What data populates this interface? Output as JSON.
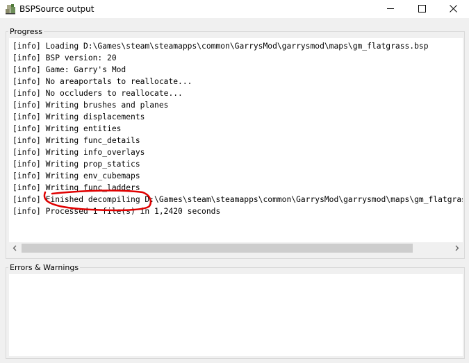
{
  "window": {
    "title": "BSPSource output",
    "app_icon": "bspsource-app-icon",
    "controls": [
      "minimize-icon",
      "maximize-icon",
      "close-icon"
    ]
  },
  "progress": {
    "label": "Progress",
    "lines": [
      "[info] Loading D:\\Games\\steam\\steamapps\\common\\GarrysMod\\garrysmod\\maps\\gm_flatgrass.bsp",
      "[info] BSP version: 20",
      "[info] Game: Garry's Mod",
      "[info] No areaportals to reallocate...",
      "[info] No occluders to reallocate...",
      "[info] Writing brushes and planes",
      "[info] Writing displacements",
      "[info] Writing entities",
      "[info] Writing func_details",
      "[info] Writing info_overlays",
      "[info] Writing prop_statics",
      "[info] Writing env_cubemaps",
      "[info] Writing func_ladders",
      "[info] Finished decompiling D:\\Games\\steam\\steamapps\\common\\GarrysMod\\garrysmod\\maps\\gm_flatgrass.bsp",
      "[info] Processed 1 file(s) in 1,2420 seconds"
    ],
    "highlight_color": "#e00000"
  },
  "errors": {
    "label": "Errors & Warnings",
    "lines": []
  },
  "scrollbar": {
    "left_arrow": "chevron-left-icon",
    "right_arrow": "chevron-right-icon"
  }
}
